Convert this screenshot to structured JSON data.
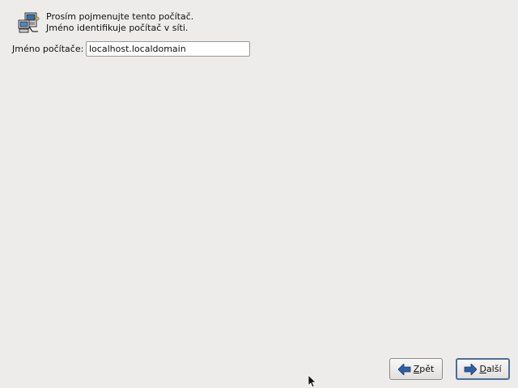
{
  "header": {
    "icon": "network-computer-icon",
    "line1": "Prosím pojmenujte tento počítač.",
    "line2": "Jméno identifikuje počítač v síti."
  },
  "hostname": {
    "label": "Jméno počítače:",
    "value": "localhost.localdomain"
  },
  "buttons": {
    "back_mnemonic": "Z",
    "back_rest": "pět",
    "next_mnemonic": "D",
    "next_rest": "alší"
  },
  "colors": {
    "background": "#edeceb",
    "arrow_blue": "#2f5fa8",
    "focus_border": "#4d6e96"
  }
}
